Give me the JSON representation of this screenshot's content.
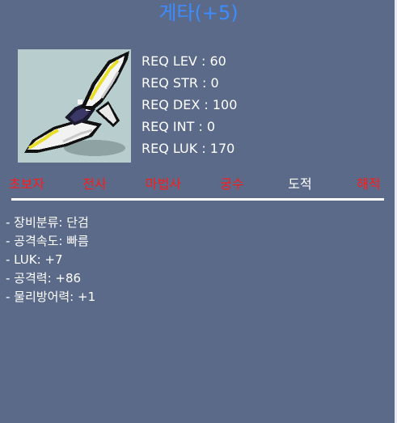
{
  "item": {
    "name": "게타(+5)",
    "icon": "dagger-icon"
  },
  "requirements": [
    "REQ LEV : 60",
    "REQ STR : 0",
    "REQ DEX : 100",
    "REQ INT : 0",
    "REQ LUK : 170"
  ],
  "jobs": [
    {
      "label": "초보자",
      "allowed": false
    },
    {
      "label": "전사",
      "allowed": false
    },
    {
      "label": "마법사",
      "allowed": false
    },
    {
      "label": "궁수",
      "allowed": false
    },
    {
      "label": "도적",
      "allowed": true
    },
    {
      "label": "해적",
      "allowed": false
    }
  ],
  "stats": [
    "- 장비분류: 단검",
    "- 공격속도: 빠름",
    "- LUK: +7",
    "- 공격력: +86",
    "- 물리방어력: +1"
  ],
  "colors": {
    "background": "#5b6a89",
    "title": "#3d8cff",
    "job_disallowed": "#ff1a1a",
    "job_allowed": "#ffffff",
    "icon_background": "#b7cdce"
  }
}
